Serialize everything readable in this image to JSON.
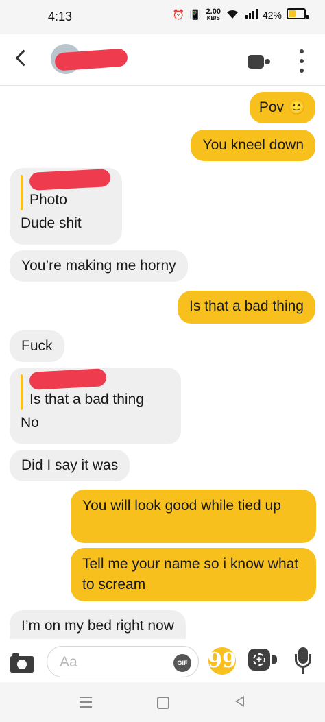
{
  "status_bar": {
    "time": "4:13",
    "speed_value": "2.00",
    "speed_unit": "KB/S",
    "battery": "42%",
    "icons": [
      "alarm-icon",
      "vibrate-icon",
      "wifi-icon",
      "signal-icon",
      "battery-icon"
    ]
  },
  "header": {
    "icons": [
      "back-icon",
      "avatar",
      "video-call-icon",
      "more-icon"
    ]
  },
  "messages": [
    {
      "direction": "outgoing",
      "text": "Pov 🙂"
    },
    {
      "direction": "outgoing",
      "text": "You kneel down"
    },
    {
      "direction": "incoming",
      "quote": "Photo",
      "text": "Dude shit"
    },
    {
      "direction": "incoming",
      "text": "You’re making me horny"
    },
    {
      "direction": "outgoing",
      "text": "Is that a bad thing"
    },
    {
      "direction": "incoming",
      "text": "Fuck"
    },
    {
      "direction": "incoming",
      "quote": "Is that a bad thing",
      "text": "No"
    },
    {
      "direction": "incoming",
      "text": "Did I say it was"
    },
    {
      "direction": "outgoing",
      "text": "You will look good while tied up"
    },
    {
      "direction": "outgoing",
      "text": "Tell me your name so i know what to scream"
    },
    {
      "direction": "incoming",
      "text": "I’m on my bed right now"
    }
  ],
  "composer": {
    "placeholder": "Aa",
    "gif_label": "GIF",
    "quote_glyph": "99",
    "icons": [
      "camera-icon",
      "gif-icon",
      "quote-icon",
      "icebreaker-icon",
      "microphone-icon"
    ]
  },
  "colors": {
    "outgoing_bubble": "#f8c01d",
    "incoming_bubble": "#efefef",
    "redaction": "#ee3b4e"
  }
}
